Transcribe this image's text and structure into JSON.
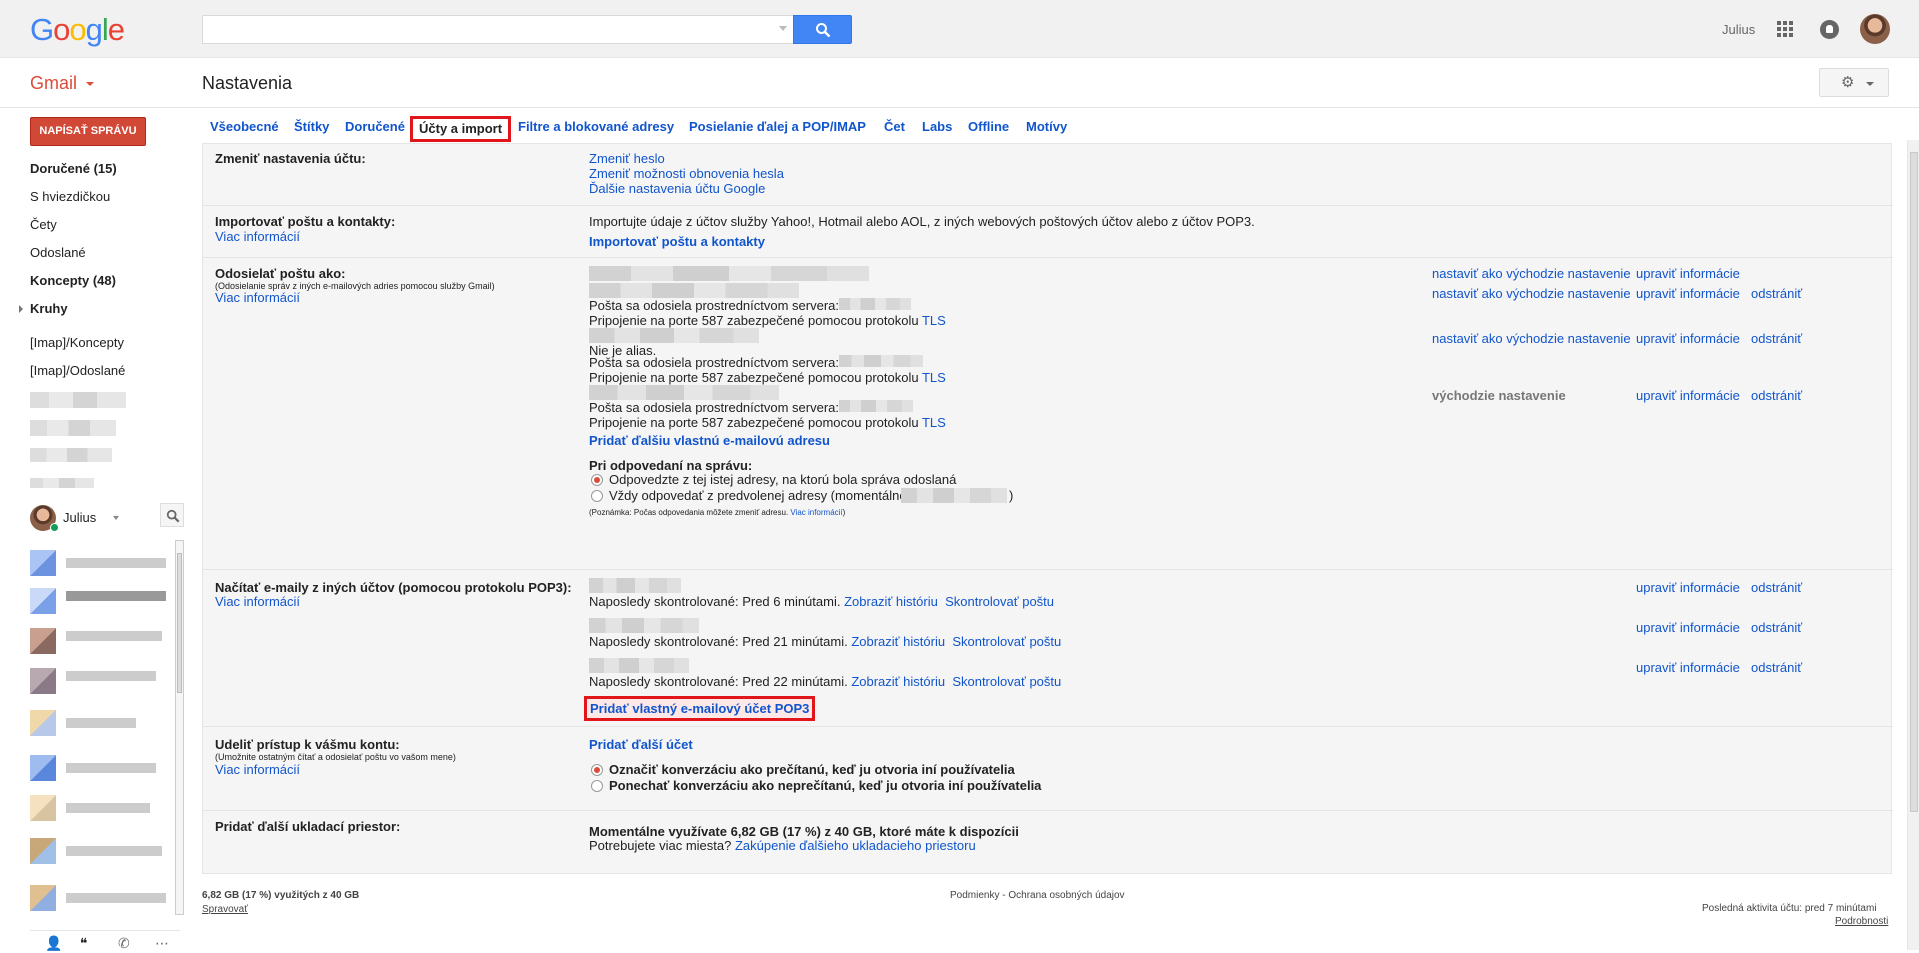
{
  "header": {
    "logo_letters": [
      "G",
      "o",
      "o",
      "g",
      "l",
      "e"
    ],
    "user_name": "Julius",
    "search_placeholder": ""
  },
  "subheader": {
    "app_label": "Gmail",
    "page_title": "Nastavenia"
  },
  "left_nav": {
    "compose_label": "NAPÍSAŤ SPRÁVU",
    "items": [
      {
        "label": "Doručené (15)",
        "bold": true
      },
      {
        "label": "S hviezdičkou",
        "bold": false
      },
      {
        "label": "Čety",
        "bold": false
      },
      {
        "label": "Odoslané",
        "bold": false
      },
      {
        "label": "Koncepty (48)",
        "bold": true
      },
      {
        "label": "Kruhy",
        "bold": true
      },
      {
        "label": "[Imap]/Koncepty",
        "bold": false
      },
      {
        "label": "[Imap]/Odoslané",
        "bold": false
      }
    ],
    "chat_user": "Julius"
  },
  "tabs": [
    {
      "label": "Všeobecné",
      "active": false
    },
    {
      "label": "Štítky",
      "active": false
    },
    {
      "label": "Doručené",
      "active": false
    },
    {
      "label": "Účty a import",
      "active": true
    },
    {
      "label": "Filtre a blokované adresy",
      "active": false
    },
    {
      "label": "Posielanie ďalej a POP/IMAP",
      "active": false
    },
    {
      "label": "Čet",
      "active": false
    },
    {
      "label": "Labs",
      "active": false
    },
    {
      "label": "Offline",
      "active": false
    },
    {
      "label": "Motívy",
      "active": false
    }
  ],
  "change_account": {
    "label": "Zmeniť nastavenia účtu:",
    "links": [
      "Zmeniť heslo",
      "Zmeniť možnosti obnovenia hesla",
      "Ďalšie nastavenia účtu Google"
    ]
  },
  "import": {
    "label": "Importovať poštu a kontakty:",
    "more": "Viac informácií",
    "description": "Importujte údaje z účtov služby Yahoo!, Hotmail alebo AOL, z iných webových poštových účtov alebo z účtov POP3.",
    "action": "Importovať poštu a kontakty"
  },
  "send_as": {
    "label": "Odosielať poštu ako:",
    "sub": "(Odosielanie správ z iných e-mailových adries pomocou služby Gmail)",
    "more": "Viac informácií",
    "server_text": "Pošta sa odosiela prostredníctvom servera:",
    "port_text": "Pripojenie na porte 587 zabezpečené pomocou protokolu",
    "tls": "TLS",
    "not_alias": "Nie je alias.",
    "set_default": "nastaviť ako východzie nastavenie",
    "edit_info": "upraviť informácie",
    "remove": "odstrániť",
    "default_label": "východzie nastavenie",
    "add_address": "Pridať ďalšiu vlastnú e-mailovú adresu",
    "reply_label": "Pri odpovedaní na správu:",
    "reply_option1": "Odpovedzte z tej istej adresy, na ktorú bola správa odoslaná",
    "reply_option2": "Vždy odpovedať z predvolenej adresy (momentálne",
    "reply_option2_end": ")",
    "note": "(Poznámka: Počas odpovedania môžete zmeniť adresu.",
    "note_more": "Viac informácií",
    "note_end": ")"
  },
  "pop3": {
    "label": "Načítať e-maily z iných účtov (pomocou protokolu POP3):",
    "more": "Viac informácií",
    "accounts": [
      {
        "checked": "Naposledy skontrolované: Pred 6 minútami."
      },
      {
        "checked": "Naposledy skontrolované: Pred 21 minútami."
      },
      {
        "checked": "Naposledy skontrolované: Pred 22 minútami."
      }
    ],
    "history": "Zobraziť históriu",
    "check": "Skontrolovať poštu",
    "edit_info": "upraviť informácie",
    "remove": "odstrániť",
    "add_pop3": "Pridať vlastný e-mailový účet POP3"
  },
  "grant": {
    "label": "Udeliť prístup k vášmu kontu:",
    "sub": "(Umožnite ostatným čítať a odosielať poštu vo vašom mene)",
    "more": "Viac informácií",
    "add": "Pridať ďalší účet",
    "option1": "Označiť konverzáciu ako prečítanú, keď ju otvoria iní používatelia",
    "option2": "Ponechať konverzáciu ako neprečítanú, keď ju otvoria iní používatelia"
  },
  "storage": {
    "label": "Pridať ďalší ukladací priestor:",
    "usage": "Momentálne využívate 6,82 GB (17 %) z 40 GB, ktoré máte k dispozícii",
    "need_more": "Potrebujete viac miesta?",
    "buy": "Zakúpenie ďalšieho ukladacieho priestoru"
  },
  "footer": {
    "usage": "6,82 GB (17 %) využitých z 40 GB",
    "manage": "Spravovať",
    "terms": "Podmienky",
    "sep": " - ",
    "privacy": "Ochrana osobných údajov",
    "last_activity": "Posledná aktivita účtu: pred 7 minútami",
    "details": "Podrobnosti"
  },
  "colors": {
    "link": "#1155cc",
    "compose": "#d14836",
    "highlight_border": "#e0161b",
    "search_button": "#4285f4",
    "panel_bg": "#f5f5f5"
  },
  "icons": {
    "search": "search-icon",
    "apps": "apps-grid-icon",
    "notifications": "notifications-icon",
    "settings": "gear-icon"
  }
}
